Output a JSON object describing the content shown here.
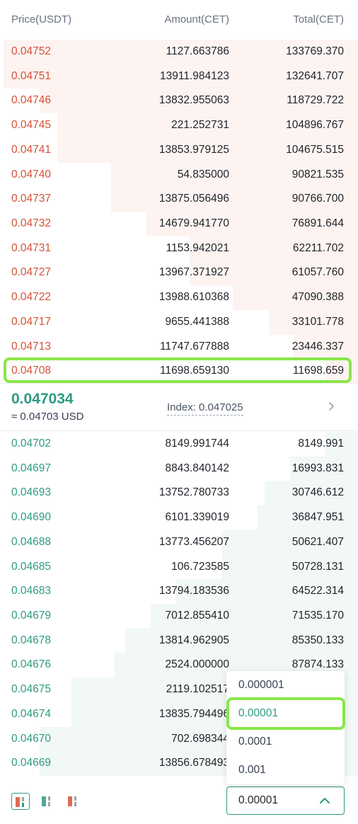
{
  "header": {
    "price": "Price(USDT)",
    "amount": "Amount(CET)",
    "total": "Total(CET)"
  },
  "asks": [
    {
      "price": "0.04752",
      "amount": "1127.663786",
      "total": "133769.370",
      "depth": 0.99
    },
    {
      "price": "0.04751",
      "amount": "13911.984123",
      "total": "132641.707",
      "depth": 0.99
    },
    {
      "price": "0.04746",
      "amount": "13832.955063",
      "total": "118729.722",
      "depth": 0.89
    },
    {
      "price": "0.04745",
      "amount": "221.252731",
      "total": "104896.767",
      "depth": 0.84
    },
    {
      "price": "0.04741",
      "amount": "13853.979125",
      "total": "104675.515",
      "depth": 0.84
    },
    {
      "price": "0.04740",
      "amount": "54.835000",
      "total": "90821.535",
      "depth": 0.69
    },
    {
      "price": "0.04737",
      "amount": "13875.056496",
      "total": "90766.700",
      "depth": 0.69
    },
    {
      "price": "0.04732",
      "amount": "14679.941770",
      "total": "76891.644",
      "depth": 0.59
    },
    {
      "price": "0.04731",
      "amount": "1153.942021",
      "total": "62211.702",
      "depth": 0.47
    },
    {
      "price": "0.04727",
      "amount": "13967.371927",
      "total": "61057.760",
      "depth": 0.47
    },
    {
      "price": "0.04722",
      "amount": "13988.610368",
      "total": "47090.388",
      "depth": 0.35
    },
    {
      "price": "0.04717",
      "amount": "9655.441388",
      "total": "33101.778",
      "depth": 0.25
    },
    {
      "price": "0.04713",
      "amount": "11747.677888",
      "total": "23446.337",
      "depth": 0.18
    },
    {
      "price": "0.04708",
      "amount": "11698.659130",
      "total": "11698.659",
      "depth": 0.09
    }
  ],
  "mid": {
    "last_price": "0.047034",
    "usd_value": "≈ 0.04703 USD",
    "index": "Index: 0.047025"
  },
  "bids": [
    {
      "price": "0.04702",
      "amount": "8149.991744",
      "total": "8149.991",
      "depth": 0.09
    },
    {
      "price": "0.04697",
      "amount": "8843.840142",
      "total": "16993.831",
      "depth": 0.19
    },
    {
      "price": "0.04693",
      "amount": "13752.780733",
      "total": "30746.612",
      "depth": 0.26
    },
    {
      "price": "0.04690",
      "amount": "6101.339019",
      "total": "36847.951",
      "depth": 0.28
    },
    {
      "price": "0.04688",
      "amount": "13773.456207",
      "total": "50621.407",
      "depth": 0.38
    },
    {
      "price": "0.04685",
      "amount": "106.723585",
      "total": "50728.131",
      "depth": 0.38
    },
    {
      "price": "0.04683",
      "amount": "13794.183536",
      "total": "64522.314",
      "depth": 0.51
    },
    {
      "price": "0.04679",
      "amount": "7012.855410",
      "total": "71535.170",
      "depth": 0.58
    },
    {
      "price": "0.04678",
      "amount": "13814.962905",
      "total": "85350.133",
      "depth": 0.65
    },
    {
      "price": "0.04676",
      "amount": "2524.000000",
      "total": "87874.133",
      "depth": 0.68
    },
    {
      "price": "0.04675",
      "amount": "2119.102517",
      "total": "",
      "depth": 0.8
    },
    {
      "price": "0.04674",
      "amount": "13835.794496",
      "total": "",
      "depth": 0.8
    },
    {
      "price": "0.04670",
      "amount": "702.698344",
      "total": "",
      "depth": 0.89
    },
    {
      "price": "0.04669",
      "amount": "13856.678493",
      "total": "",
      "depth": 0.89
    }
  ],
  "precision": {
    "selected": "0.00001",
    "options": [
      "0.000001",
      "0.00001",
      "0.0001",
      "0.001"
    ]
  },
  "colors": {
    "ask": "#d35237",
    "bid": "#2f9a82",
    "accent": "#2f9a82",
    "highlight": "#8ae64a"
  }
}
